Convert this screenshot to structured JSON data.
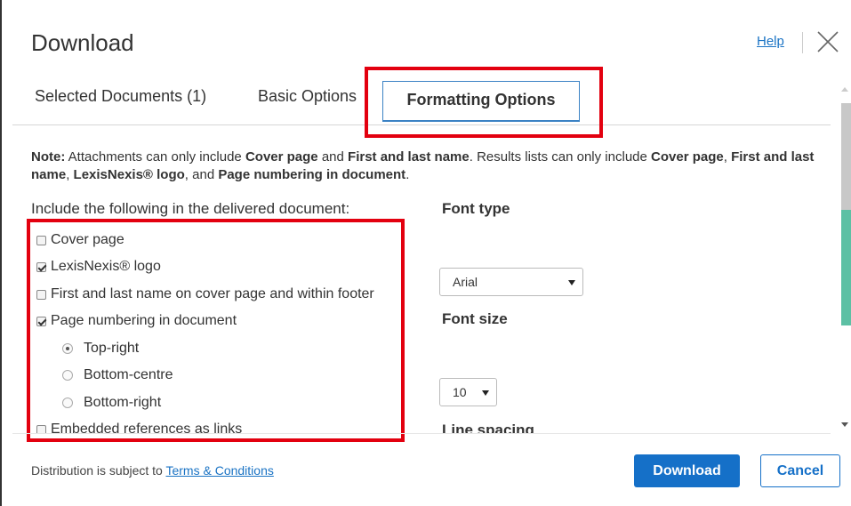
{
  "dialog": {
    "title": "Download",
    "help_label": "Help",
    "close_icon": "close-icon"
  },
  "tabs": [
    {
      "label": "Selected Documents (1)",
      "active": false
    },
    {
      "label": "Basic Options",
      "active": false
    },
    {
      "label": "Formatting Options",
      "active": true
    }
  ],
  "note": {
    "prefix": "Note:",
    "part1": " Attachments can only include ",
    "b1": "Cover page",
    "part2": " and ",
    "b2": "First and last name",
    "part3": ". Results lists can only include ",
    "b3": "Cover page",
    "part4": ", ",
    "b4": "First and last name",
    "part5": ", ",
    "b5": "LexisNexis® logo",
    "part6": ", and ",
    "b6": "Page numbering in document",
    "part7": "."
  },
  "include_section": {
    "heading": "Include the following in the delivered document:",
    "options": [
      {
        "label": "Cover page",
        "checked": false
      },
      {
        "label": "LexisNexis® logo",
        "checked": true
      },
      {
        "label": "First and last name on cover page and within footer",
        "checked": false
      },
      {
        "label": "Page numbering in document",
        "checked": true
      },
      {
        "label": "Embedded references as links",
        "checked": false
      }
    ],
    "page_number_positions": [
      {
        "label": "Top-right",
        "selected": true
      },
      {
        "label": "Bottom-centre",
        "selected": false
      },
      {
        "label": "Bottom-right",
        "selected": false
      }
    ]
  },
  "font_type": {
    "heading": "Font type",
    "value": "Arial"
  },
  "font_size": {
    "heading": "Font size",
    "value": "10"
  },
  "line_spacing": {
    "heading": "Line spacing"
  },
  "footer": {
    "text": "Distribution is subject to ",
    "link": "Terms & Conditions",
    "download_label": "Download",
    "cancel_label": "Cancel"
  },
  "colors": {
    "primary": "#1570c8",
    "highlight": "#e3000f",
    "scroll_accent": "#5cc0a4",
    "link": "#1a73c4"
  }
}
